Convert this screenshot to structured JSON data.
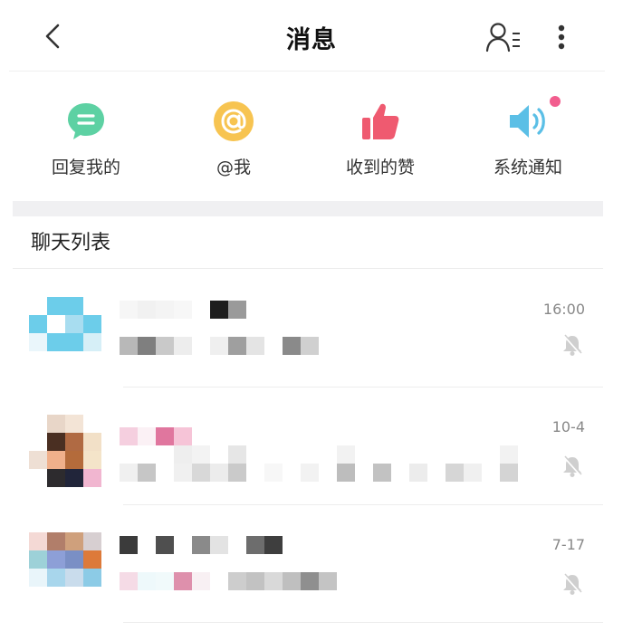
{
  "header": {
    "title": "消息",
    "back_icon": "chevron-left-icon",
    "contacts_icon": "contacts-list-icon",
    "more_icon": "more-vertical-icon"
  },
  "quick_actions": [
    {
      "label": "回复我的",
      "icon": "reply-bubble-icon",
      "color": "#5dd1a3"
    },
    {
      "label": "@我",
      "icon": "at-sign-icon",
      "color": "#f7c451"
    },
    {
      "label": "收到的赞",
      "icon": "thumbs-up-icon",
      "color": "#ef5a70"
    },
    {
      "label": "系统通知",
      "icon": "speaker-icon",
      "color": "#5bbfe6",
      "badge": true
    }
  ],
  "section": {
    "title": "聊天列表"
  },
  "chats": [
    {
      "time": "16:00",
      "muted": true
    },
    {
      "time": "10-4",
      "muted": true
    },
    {
      "time": "7-17",
      "muted": true
    }
  ],
  "colors": {
    "accent_badge": "#f25d8e",
    "time_text": "#888888"
  }
}
